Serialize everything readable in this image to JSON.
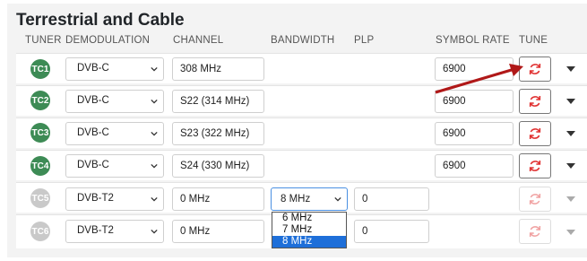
{
  "title": "Terrestrial and Cable",
  "headers": {
    "tuner": "TUNER",
    "demodulation": "DEMODULATION",
    "channel": "CHANNEL",
    "bandwidth": "BANDWIDTH",
    "plp": "PLP",
    "symbol_rate": "SYMBOL RATE",
    "tune": "TUNE"
  },
  "rows": [
    {
      "tuner": "TC1",
      "demodulation": "DVB-C",
      "channel": "308 MHz",
      "symbol_rate": "6900",
      "enabled": true
    },
    {
      "tuner": "TC2",
      "demodulation": "DVB-C",
      "channel": "S22 (314 MHz)",
      "symbol_rate": "6900",
      "enabled": true
    },
    {
      "tuner": "TC3",
      "demodulation": "DVB-C",
      "channel": "S23 (322 MHz)",
      "symbol_rate": "6900",
      "enabled": true
    },
    {
      "tuner": "TC4",
      "demodulation": "DVB-C",
      "channel": "S24 (330 MHz)",
      "symbol_rate": "6900",
      "enabled": true
    },
    {
      "tuner": "TC5",
      "demodulation": "DVB-T2",
      "channel": "0 MHz",
      "bandwidth": "8 MHz",
      "plp": "0",
      "enabled": false
    },
    {
      "tuner": "TC6",
      "demodulation": "DVB-T2",
      "channel": "0 MHz",
      "plp": "0",
      "enabled": false
    }
  ],
  "bandwidth_options": [
    "6 MHz",
    "7 MHz",
    "8 MHz"
  ],
  "bandwidth_selected": "8 MHz",
  "colors": {
    "badge_active": "#3d8b55",
    "badge_inactive": "#c9c9c9",
    "tune_icon": "#e03030",
    "arrow": "#b01818",
    "highlight": "#1e6fd9"
  },
  "icons": {
    "tune": "refresh-icon",
    "expand": "caret-down-icon"
  }
}
